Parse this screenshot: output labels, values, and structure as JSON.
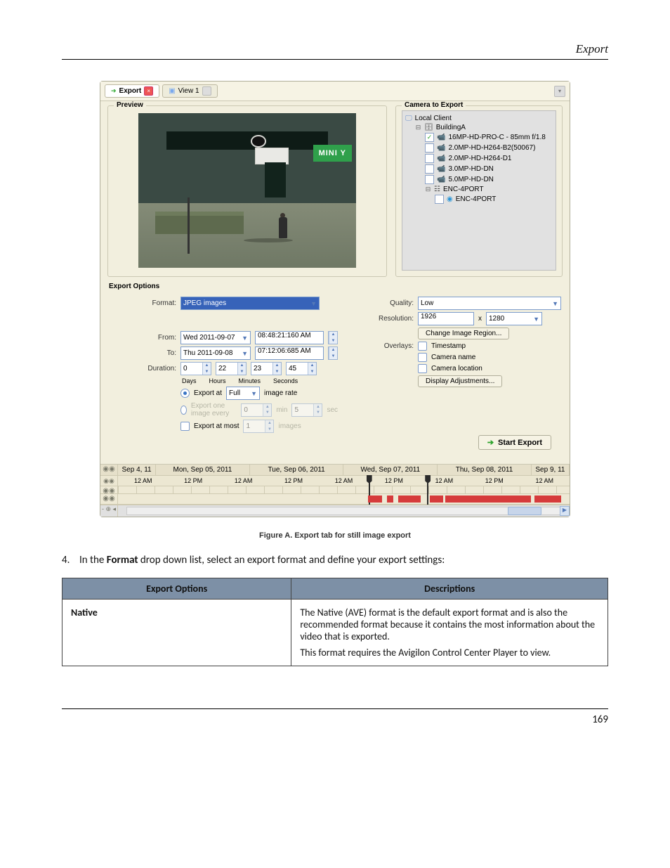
{
  "header": {
    "title": "Export"
  },
  "tabs": {
    "export": "Export",
    "view1": "View 1"
  },
  "preview": {
    "legend": "Preview",
    "sign": "MINI Y"
  },
  "camera": {
    "legend": "Camera to Export",
    "root": "Local Client",
    "server": "BuildingA",
    "items": [
      {
        "label": "16MP-HD-PRO-C - 85mm f/1.8",
        "checked": true
      },
      {
        "label": "2.0MP-HD-H264-B2(50067)",
        "checked": false
      },
      {
        "label": "2.0MP-HD-H264-D1",
        "checked": false
      },
      {
        "label": "3.0MP-HD-DN",
        "checked": false
      },
      {
        "label": "5.0MP-HD-DN",
        "checked": false
      }
    ],
    "encoder": "ENC-4PORT",
    "encoderCam": "ENC-4PORT"
  },
  "options": {
    "title": "Export Options",
    "formatLabel": "Format:",
    "formatValue": "JPEG images",
    "fromLabel": "From:",
    "fromDate": "Wed 2011-09-07",
    "fromTime": "08:48:21:160  AM",
    "toLabel": "To:",
    "toDate": "Thu 2011-09-08",
    "toTime": "07:12:06:685  AM",
    "durationLabel": "Duration:",
    "durDays": "0",
    "durHours": "22",
    "durMins": "23",
    "durSecs": "45",
    "unitDays": "Days",
    "unitHours": "Hours",
    "unitMins": "Minutes",
    "unitSecs": "Seconds",
    "exportAt": "Export at",
    "fullLabel": "Full",
    "imageRate": "image rate",
    "exportEvery": "Export one image every",
    "min": "min",
    "sec": "sec",
    "everyMin": "0",
    "everySec": "5",
    "exportAtMost": "Export at most",
    "atMostVal": "1",
    "imagesWord": "images",
    "qualityLabel": "Quality:",
    "qualityValue": "Low",
    "resLabel": "Resolution:",
    "resW": "1926",
    "resX": "x",
    "resH": "1280",
    "changeRegion": "Change Image Region...",
    "overlaysLabel": "Overlays:",
    "ovTimestamp": "Timestamp",
    "ovCamName": "Camera name",
    "ovCamLoc": "Camera location",
    "dispAdj": "Display Adjustments...",
    "startExport": "Start Export"
  },
  "timeline": {
    "days": [
      "Sep 4, 11",
      "Mon, Sep 05, 2011",
      "Tue, Sep 06, 2011",
      "Wed, Sep 07, 2011",
      "Thu, Sep 08, 2011",
      "Sep 9, 11"
    ],
    "hours": [
      "12 AM",
      "12 PM",
      "12 AM",
      "12 PM",
      "12 AM",
      "12 PM",
      "12 AM",
      "12 PM",
      "12 AM"
    ]
  },
  "caption": "Figure A.     Export tab for still image export",
  "instruction": "4.    In the Format drop down list, select an export format and define your export settings:",
  "table": {
    "headerOption": "Export Options",
    "headerDesc": "Descriptions",
    "cellOption": "Native",
    "cellDesc1": "The Native (AVE) format is the default export format and is also the recommended format because it contains the most information about the video that is exported.",
    "cellDesc2": "This format requires the Avigilon Control Center Player to view."
  },
  "footer": {
    "page": "169"
  }
}
